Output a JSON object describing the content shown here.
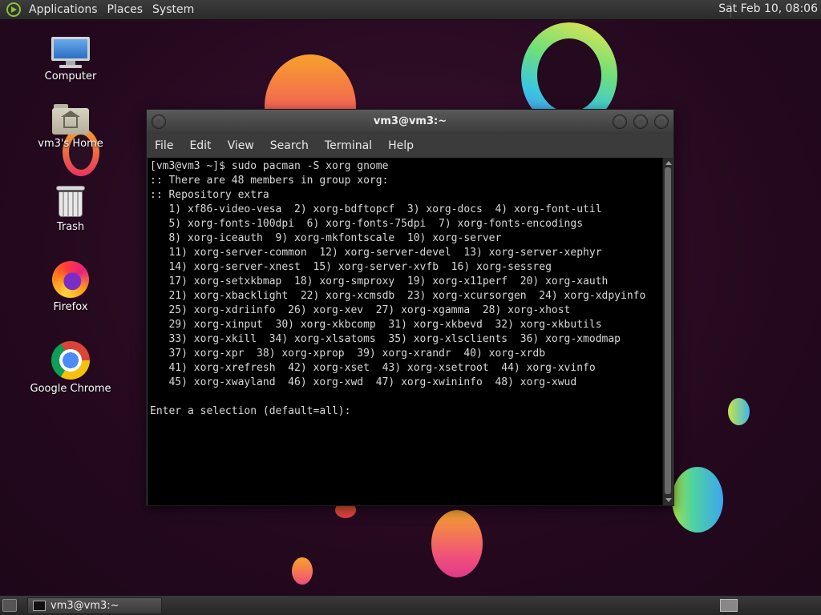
{
  "top_panel": {
    "menus": [
      "Applications",
      "Places",
      "System"
    ],
    "clock": "Sat Feb 10, 08:06"
  },
  "desktop": {
    "icons": [
      {
        "label": "Computer",
        "icon": "computer-icon"
      },
      {
        "label": "vm3's Home",
        "icon": "home-folder-icon"
      },
      {
        "label": "Trash",
        "icon": "trash-icon"
      },
      {
        "label": "Firefox",
        "icon": "firefox-icon"
      },
      {
        "label": "Google Chrome",
        "icon": "chrome-icon"
      }
    ]
  },
  "terminal": {
    "title": "vm3@vm3:~",
    "menu": [
      "File",
      "Edit",
      "View",
      "Search",
      "Terminal",
      "Help"
    ],
    "lines": [
      "[vm3@vm3 ~]$ sudo pacman -S xorg gnome",
      ":: There are 48 members in group xorg:",
      ":: Repository extra",
      "   1) xf86-video-vesa  2) xorg-bdftopcf  3) xorg-docs  4) xorg-font-util",
      "   5) xorg-fonts-100dpi  6) xorg-fonts-75dpi  7) xorg-fonts-encodings",
      "   8) xorg-iceauth  9) xorg-mkfontscale  10) xorg-server",
      "   11) xorg-server-common  12) xorg-server-devel  13) xorg-server-xephyr",
      "   14) xorg-server-xnest  15) xorg-server-xvfb  16) xorg-sessreg",
      "   17) xorg-setxkbmap  18) xorg-smproxy  19) xorg-x11perf  20) xorg-xauth",
      "   21) xorg-xbacklight  22) xorg-xcmsdb  23) xorg-xcursorgen  24) xorg-xdpyinfo",
      "   25) xorg-xdriinfo  26) xorg-xev  27) xorg-xgamma  28) xorg-xhost",
      "   29) xorg-xinput  30) xorg-xkbcomp  31) xorg-xkbevd  32) xorg-xkbutils",
      "   33) xorg-xkill  34) xorg-xlsatoms  35) xorg-xlsclients  36) xorg-xmodmap",
      "   37) xorg-xpr  38) xorg-xprop  39) xorg-xrandr  40) xorg-xrdb",
      "   41) xorg-xrefresh  42) xorg-xset  43) xorg-xsetroot  44) xorg-xvinfo",
      "   45) xorg-xwayland  46) xorg-xwd  47) xorg-xwininfo  48) xorg-xwud",
      "",
      "Enter a selection (default=all): "
    ]
  },
  "taskbar": {
    "window_button": "vm3@vm3:~"
  }
}
